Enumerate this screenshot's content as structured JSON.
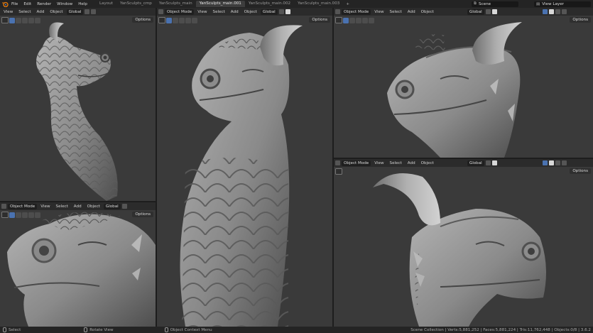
{
  "topbar": {
    "menus": [
      "File",
      "Edit",
      "Render",
      "Window",
      "Help"
    ],
    "workspaces": [
      "Layout",
      "YanSculpts_cmp",
      "YanSculpts_main",
      "YanSculpts_main.001",
      "YanSculpts_main.002",
      "YanSculpts_main.003"
    ],
    "active_workspace": "YanSculpts_main.001",
    "add_workspace": "+",
    "scene_label": "Scene",
    "view_layer_label": "View Layer"
  },
  "viewport_header": {
    "mode": "Object Mode",
    "view": "View",
    "select": "Select",
    "add": "Add",
    "object": "Object",
    "orientation": "Global",
    "options": "Options"
  },
  "statusbar": {
    "left_action": "Select",
    "middle_action": "Rotate View",
    "right_action": "Object Context Menu",
    "stats": "Scene Collection | Verts:5,881,252 | Faces:5,881,224 | Tris:11,762,448 | Objects:0/8 | 3.6.2"
  },
  "colors": {
    "viewport_bg": "#3a3a3a",
    "header_bg": "#2b2b2b",
    "topbar_bg": "#242424",
    "accent_blue": "#4a72b0",
    "model_light": "#9c9c9c",
    "model_dark": "#4a4a4a"
  }
}
